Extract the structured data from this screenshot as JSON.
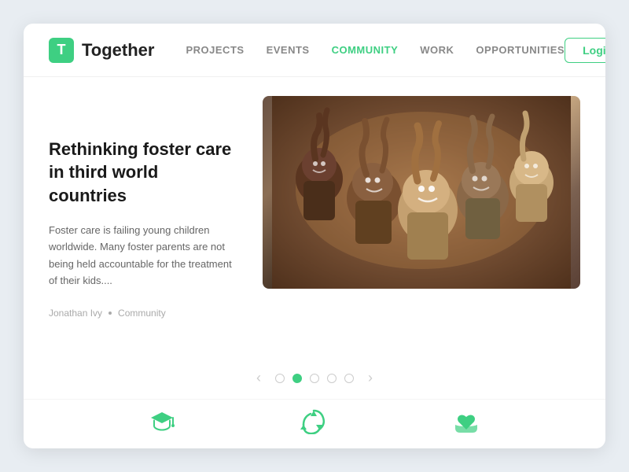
{
  "brand": {
    "logo_letter": "T",
    "name": "Together"
  },
  "nav": {
    "links": [
      {
        "label": "PROJECTS",
        "active": false
      },
      {
        "label": "EVENTS",
        "active": false
      },
      {
        "label": "COMMUNITY",
        "active": true
      },
      {
        "label": "WORK",
        "active": false
      },
      {
        "label": "OPPORTUNITIES",
        "active": false
      }
    ],
    "login_label": "Login"
  },
  "article": {
    "title": "Rethinking foster care in third world countries",
    "description": "Foster care is failing young children worldwide. Many foster parents are not being held accountable for the treatment of their kids....",
    "author": "Jonathan Ivy",
    "category": "Community"
  },
  "pagination": {
    "prev_label": "‹",
    "next_label": "›",
    "dots": [
      false,
      true,
      false,
      false,
      false
    ]
  },
  "bottom_icons": [
    {
      "name": "graduation-cap",
      "symbol": "🎓"
    },
    {
      "name": "recycle",
      "symbol": "♻"
    },
    {
      "name": "care-hands",
      "symbol": "🤲"
    }
  ]
}
